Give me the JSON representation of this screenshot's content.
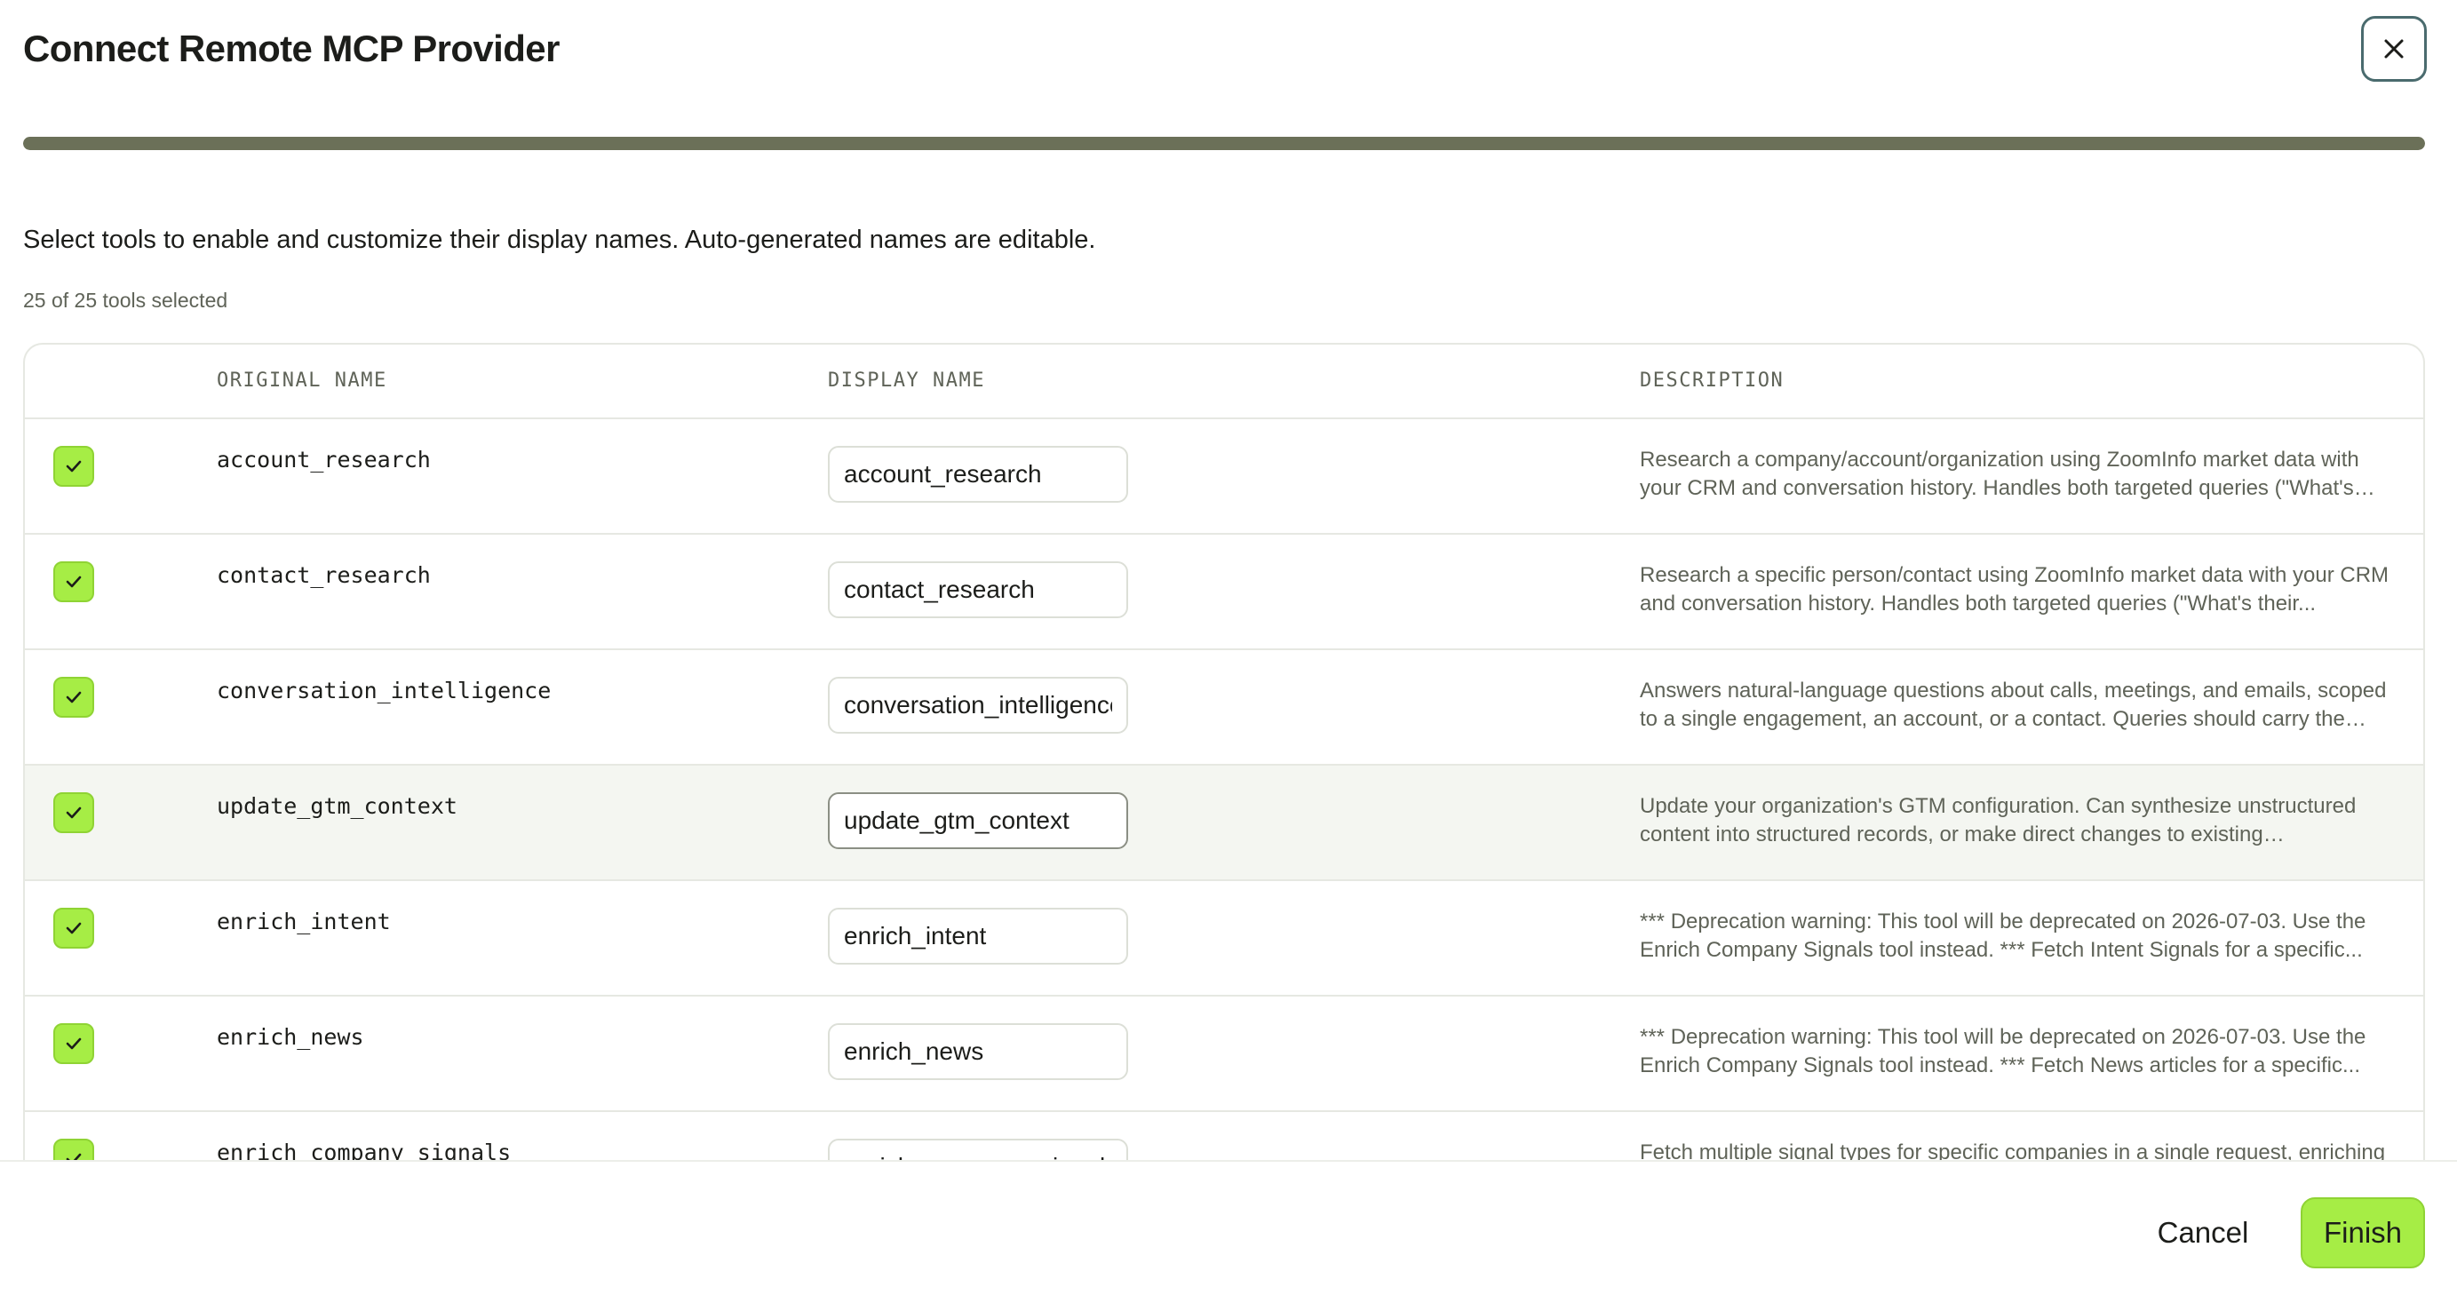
{
  "dialog": {
    "title": "Connect Remote MCP Provider",
    "close_icon": "close-icon",
    "progress_fraction": 1.0,
    "progress_color": "#6b7058"
  },
  "instructions": "Select tools to enable and customize their display names. Auto-generated names are editable.",
  "selected_count": "25 of 25 tools selected",
  "table": {
    "headers": {
      "original_name": "ORIGINAL NAME",
      "display_name": "DISPLAY NAME",
      "description": "DESCRIPTION"
    },
    "rows": [
      {
        "checked": true,
        "original_name": "account_research",
        "display_name": "account_research",
        "description": "Research a company/account/organization using ZoomInfo market data with your CRM and conversation history. Handles both targeted queries (\"What's their recen..."
      },
      {
        "checked": true,
        "original_name": "contact_research",
        "display_name": "contact_research",
        "description": "Research a specific person/contact using ZoomInfo market data with your CRM and conversation history. Handles both targeted queries (\"What's their..."
      },
      {
        "checked": true,
        "original_name": "conversation_intelligence",
        "display_name": "conversation_intelligence",
        "description": "Answers natural-language questions about calls, meetings, and emails, scoped to a single engagement, an account, or a contact. Queries should carry the user's..."
      },
      {
        "checked": true,
        "original_name": "update_gtm_context",
        "display_name": "update_gtm_context",
        "description": "Update your organization's GTM configuration. Can synthesize unstructured content into structured records, or make direct changes to existing configuration...."
      },
      {
        "checked": true,
        "original_name": "enrich_intent",
        "display_name": "enrich_intent",
        "description": "*** Deprecation warning: This tool will be deprecated on 2026-07-03. Use the Enrich Company Signals tool instead. *** Fetch Intent Signals for a specific..."
      },
      {
        "checked": true,
        "original_name": "enrich_news",
        "display_name": "enrich_news",
        "description": "*** Deprecation warning: This tool will be deprecated on 2026-07-03. Use the Enrich Company Signals tool instead. *** Fetch News articles for a specific..."
      },
      {
        "checked": true,
        "original_name": "enrich_company_signals",
        "display_name": "enrich_company_signals",
        "description": "Fetch multiple signal types for specific companies in a single request, enriching"
      }
    ]
  },
  "footer": {
    "cancel_label": "Cancel",
    "finish_label": "Finish"
  },
  "colors": {
    "accent_green": "#a6ed45",
    "text_primary": "#1c1d1a",
    "text_muted": "#5f6358"
  }
}
